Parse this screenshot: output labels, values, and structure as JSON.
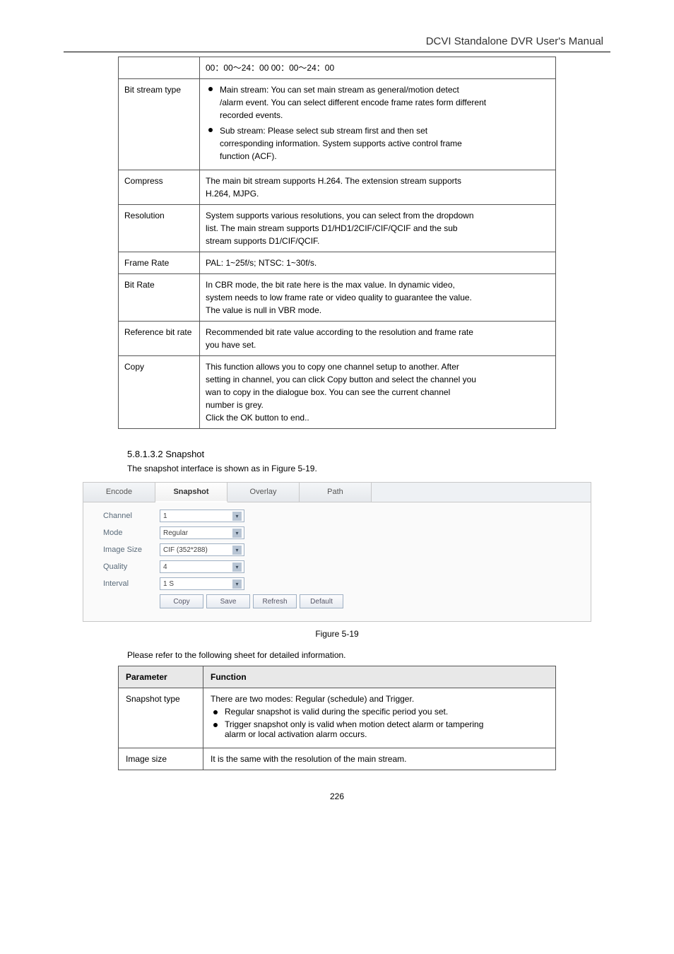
{
  "doc_title": "DCVI Standalone DVR User's Manual",
  "table1": {
    "r0_left": "",
    "r0_right": "00：00～24：00 00：00～24：00",
    "r1_left": "Bit stream type",
    "r1_right_b1": "Main stream: You can set main stream as general/motion detect",
    "r1_right_b1b": "/alarm event. You can select different encode frame rates form different",
    "r1_right_b1c": "recorded events.",
    "r1_right_b2": "Sub stream: Please select sub stream first and then set",
    "r1_right_b2b": "corresponding information. System supports active control frame",
    "r1_right_b2c": "function (ACF).",
    "r2_left": "Compress",
    "r2_right": "The main bit stream supports H.264. The extension stream supports",
    "r2_rightb": "H.264, MJPG.",
    "r3_left": "Resolution",
    "r3_right": "System supports various resolutions, you can select from the dropdown",
    "r3_rightb": "list. The main stream supports D1/HD1/2CIF/CIF/QCIF and the sub",
    "r3_rightc": "stream supports D1/CIF/QCIF.",
    "r4_left": "Frame Rate",
    "r4_right": "PAL: 1~25f/s; NTSC: 1~30f/s.",
    "r5_left": "Bit Rate",
    "r5_right": "In CBR mode, the bit rate here is the max value. In dynamic video,",
    "r5_rightb": "system needs to low frame rate or video quality to guarantee the value.",
    "r5_rightc": "The value is null in VBR mode.",
    "r6_left": "Reference bit rate",
    "r6_right": "Recommended bit rate value according to the resolution and frame rate",
    "r6_rightb": "you have set.",
    "r7_left": "Copy",
    "r7_right": "This function allows you to copy one channel setup to another. After",
    "r7_rightb": "setting in channel, you can click Copy button and select the channel you",
    "r7_rightc": "wan to copy in the dialogue box. You can see the current channel",
    "r7_rightd": "number is grey.",
    "r7_righte": "Click the OK button to end.."
  },
  "section_heading": "5.8.1.3.2 Snapshot",
  "body_text": "The snapshot interface is shown as in Figure 5-19.",
  "screenshot": {
    "tabs": {
      "t1": "Encode",
      "t2": "Snapshot",
      "t3": "Overlay",
      "t4": "Path"
    },
    "labels": {
      "channel": "Channel",
      "mode": "Mode",
      "image_size": "Image Size",
      "quality": "Quality",
      "interval": "Interval"
    },
    "values": {
      "channel": "1",
      "mode": "Regular",
      "image_size": "CIF (352*288)",
      "quality": "4",
      "interval": "1 S"
    },
    "buttons": {
      "copy": "Copy",
      "save": "Save",
      "refresh": "Refresh",
      "default": "Default"
    }
  },
  "fig_caption": "Figure 5-19",
  "ref_text": "Please refer to the following sheet for detailed information.",
  "table2": {
    "h1": "Parameter",
    "h2": "Function",
    "r1_left": "Snapshot type",
    "r1_right": "There are two modes: Regular (schedule) and Trigger.",
    "r1_b1": "Regular snapshot is valid during the specific period you set.",
    "r1_b2": "Trigger snapshot only is valid when motion detect alarm or tampering",
    "r1_b2b": "alarm or local activation alarm occurs.",
    "r2_left": "Image size",
    "r2_right": "It is the same with the resolution of the main stream."
  },
  "page_num": "226"
}
